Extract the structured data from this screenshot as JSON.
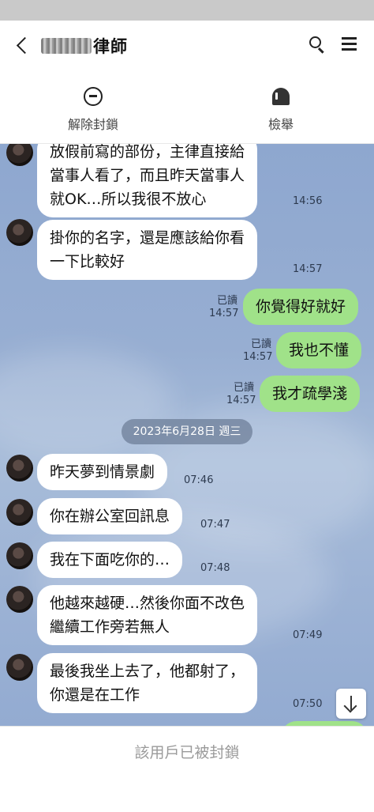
{
  "header": {
    "title": "律師",
    "name_redacted": true
  },
  "actions": {
    "unblock_label": "解除封鎖",
    "report_label": "檢舉"
  },
  "messages": [
    {
      "dir": "in",
      "lines": [
        "放假前寫的部份，主律直接給",
        "當事人看了，而且昨天當事人",
        "就OK…所以我很不放心"
      ],
      "time": "14:56"
    },
    {
      "dir": "in",
      "lines": [
        "掛你的名字，還是應該給你看",
        "一下比較好"
      ],
      "time": "14:57"
    },
    {
      "dir": "out",
      "text": "你覺得好就好",
      "read": "已讀",
      "time": "14:57"
    },
    {
      "dir": "out",
      "text": "我也不懂",
      "read": "已讀",
      "time": "14:57"
    },
    {
      "dir": "out",
      "text": "我才疏學淺",
      "read": "已讀",
      "time": "14:57"
    },
    {
      "dir": "in",
      "text": "昨天夢到情景劇",
      "time": "07:46"
    },
    {
      "dir": "in",
      "text": "你在辦公室回訊息",
      "time": "07:47"
    },
    {
      "dir": "in",
      "text": "我在下面吃你的…",
      "time": "07:48"
    },
    {
      "dir": "in",
      "lines": [
        "他越來越硬…然後你面不改色",
        "繼續工作旁若無人"
      ],
      "time": "07:49"
    },
    {
      "dir": "in",
      "lines": [
        "最後我坐上去了，他都射了，",
        "你還是在工作"
      ],
      "time": "07:50"
    }
  ],
  "date_divider": "2023年6月28日 週三",
  "blocked_notice": "該用戶已被封鎖",
  "icons": {
    "back": "chevron-left-icon",
    "search": "search-icon",
    "menu": "hamburger-menu-icon",
    "unblock": "unblock-circle-icon",
    "report": "report-icon",
    "scroll": "arrow-down-icon"
  },
  "colors": {
    "outgoing_bubble": "#a0e289",
    "incoming_bubble": "#ffffff",
    "chat_background": "#97aed2"
  }
}
